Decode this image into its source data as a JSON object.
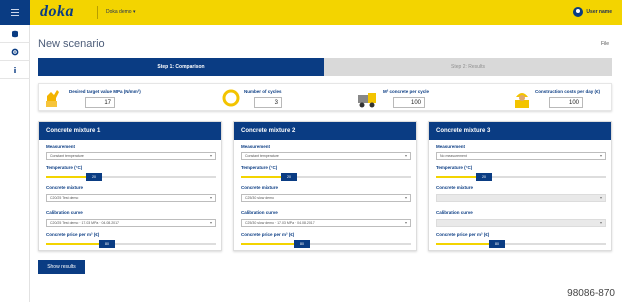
{
  "header": {
    "logo": "doka",
    "dropdown": "Doka demo ▾",
    "user": "User name"
  },
  "page": {
    "title": "New scenario",
    "file": "File"
  },
  "steps": [
    {
      "label": "Step 1: Comparison",
      "active": true
    },
    {
      "label": "Step 2: Results",
      "active": false
    }
  ],
  "params": [
    {
      "label": "Desired target value MPa (N/mm²)",
      "value": "17",
      "icon": "target-value-icon"
    },
    {
      "label": "Number of cycles",
      "value": "3",
      "icon": "cycles-icon"
    },
    {
      "label": "M² concrete per cycle",
      "value": "100",
      "icon": "concrete-truck-icon"
    },
    {
      "label": "Construction costs per day (€)",
      "value": "100",
      "icon": "construction-worker-icon"
    }
  ],
  "cards": [
    {
      "title": "Concrete mixture 1",
      "measurement_label": "Measurement",
      "measurement": "Constant temperature",
      "temperature_label": "Temperature (°C)",
      "temperature": "20",
      "temperature_fraction": 0.28,
      "mixture_label": "Concrete mixture",
      "mixture": "C20/25 Test demo",
      "calibration_label": "Calibration curve",
      "calibration": "C20/25 Test demo · 17.03 MPa · 04.08.2017",
      "price_label": "Concrete price per m³ (€)",
      "price": "80",
      "price_fraction": 0.36
    },
    {
      "title": "Concrete mixture 2",
      "measurement_label": "Measurement",
      "measurement": "Constant temperature",
      "temperature_label": "Temperature (°C)",
      "temperature": "20",
      "temperature_fraction": 0.28,
      "mixture_label": "Concrete mixture",
      "mixture": "C25/30 slow demo",
      "calibration_label": "Calibration curve",
      "calibration": "C25/30 slow demo · 17.03 MPa · 04.08.2017",
      "price_label": "Concrete price per m³ (€)",
      "price": "80",
      "price_fraction": 0.36
    },
    {
      "title": "Concrete mixture 3",
      "measurement_label": "Measurement",
      "measurement": "No measurement",
      "temperature_label": "Temperature (°C)",
      "temperature": "20",
      "temperature_fraction": 0.28,
      "mixture_label": "Concrete mixture",
      "mixture": "",
      "calibration_label": "Calibration curve",
      "calibration": "",
      "price_label": "Concrete price per m³ (€)",
      "price": "80",
      "price_fraction": 0.36
    }
  ],
  "show_results": "Show results",
  "figure_number": "98086-870",
  "colors": {
    "brand_yellow": "#f3d400",
    "brand_blue": "#0a3c83"
  }
}
